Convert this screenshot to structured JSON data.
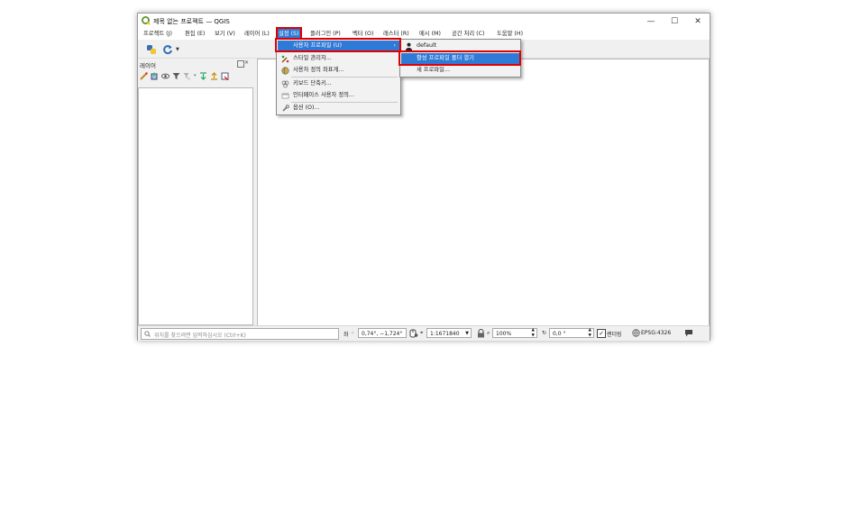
{
  "window": {
    "title": "제목 없는 프로젝트 — QGIS",
    "controls": {
      "minimize": "—",
      "maximize": "☐",
      "close": "✕"
    }
  },
  "menubar": [
    {
      "label": "프로젝트 (J)"
    },
    {
      "label": "편집 (E)"
    },
    {
      "label": "보기 (V)"
    },
    {
      "label": "레이어 (L)"
    },
    {
      "label": "설정 (S)"
    },
    {
      "label": "플러그인 (P)"
    },
    {
      "label": "벡터 (O)"
    },
    {
      "label": "래스터 (R)"
    },
    {
      "label": "메시 (M)"
    },
    {
      "label": "공간 처리 (C)"
    },
    {
      "label": "도움말 (H)"
    }
  ],
  "layers_panel": {
    "title": "레이어"
  },
  "settings_menu": {
    "items": [
      {
        "label": "사용자 프로파일 (U)",
        "submenu_arrow": "›"
      },
      {
        "label": "스타일 관리자..."
      },
      {
        "label": "사용자 정의 좌표계..."
      },
      {
        "label": "키보드 단축키..."
      },
      {
        "label": "인터페이스 사용자 정의..."
      },
      {
        "label": "옵션 (O)..."
      }
    ]
  },
  "profiles_submenu": {
    "items": [
      {
        "label": "default"
      },
      {
        "label": "활성 프로파일 폴더 열기"
      },
      {
        "label": "새 프로파일..."
      }
    ]
  },
  "statusbar": {
    "locator_placeholder": "위치를 찾으려면 입력하십시오 (Ctrl+K)",
    "coord_label": "좌",
    "coord_value": "0,74°, −1,724°",
    "scale_value": "1:1671840",
    "magnifier_value": "100%",
    "rotation_value": "0,0 °",
    "render_label": "렌더링",
    "crs": "EPSG:4326"
  },
  "colors": {
    "highlight": "#2f7ad6",
    "annotation_red": "#e00000"
  }
}
